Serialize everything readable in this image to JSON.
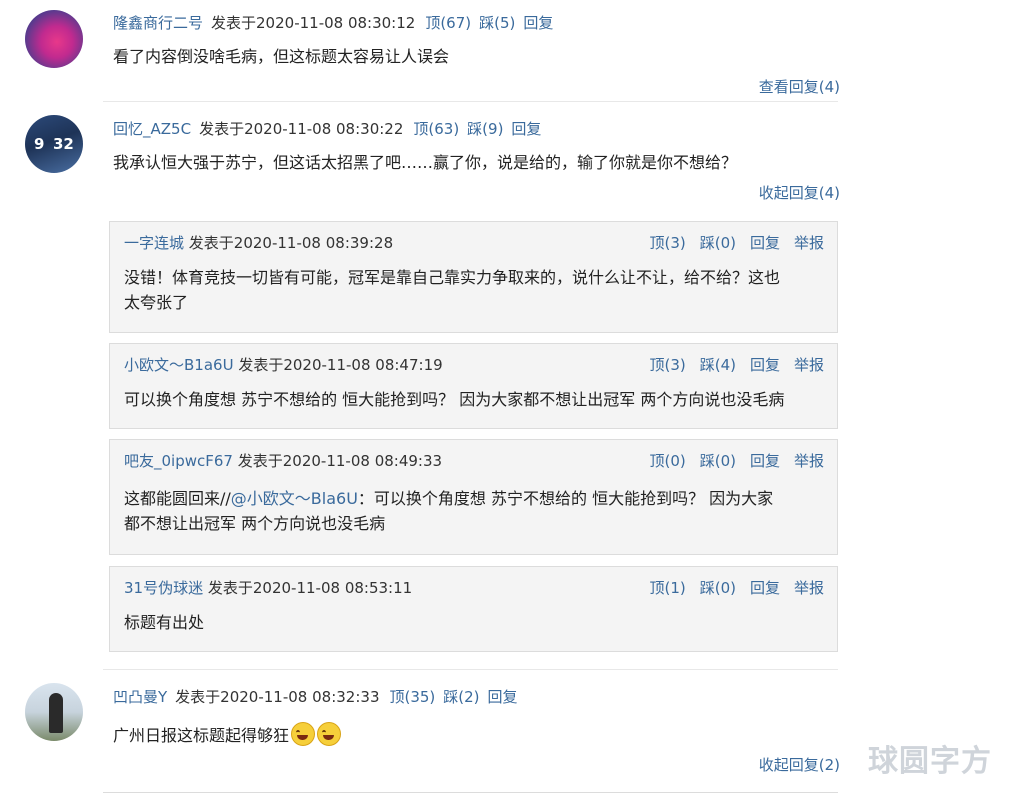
{
  "comments": [
    {
      "user": "隆鑫商行二号",
      "date": "发表于2020-11-08 08:30:12",
      "up": "顶(67)",
      "down": "踩(5)",
      "reply": "回复",
      "text": "看了内容倒没啥毛病，但这标题太容易让人误会",
      "toggle": "查看回复(4)"
    },
    {
      "user": "回忆_AZ5C",
      "date": "发表于2020-11-08 08:30:22",
      "up": "顶(63)",
      "down": "踩(9)",
      "reply": "回复",
      "text": "我承认恒大强于苏宁，但这话太招黑了吧……赢了你，说是给的，输了你就是你不想给？",
      "toggle": "收起回复(4)"
    },
    {
      "user": "凹凸曼Y",
      "date": "发表于2020-11-08 08:32:33",
      "up": "顶(35)",
      "down": "踩(2)",
      "reply": "回复",
      "text": "广州日报这标题起得够狂",
      "toggle": "收起回复(2)"
    }
  ],
  "replies": [
    {
      "user": "一字连城",
      "date": "发表于2020-11-08 08:39:28",
      "up": "顶(3)",
      "down": "踩(0)",
      "reply": "回复",
      "report": "举报",
      "line1": "没错！体育竞技一切皆有可能，冠军是靠自己靠实力争取来的，说什么让不让，给不给？这也",
      "line2": "太夸张了"
    },
    {
      "user": "小欧文～B1a6U",
      "date": "发表于2020-11-08 08:47:19",
      "up": "顶(3)",
      "down": "踩(4)",
      "reply": "回复",
      "report": "举报",
      "line1": "可以换个角度想 苏宁不想给的 恒大能抢到吗？ 因为大家都不想让出冠军 两个方向说也没毛病"
    },
    {
      "user": "吧友_0ipwcF67",
      "date": "发表于2020-11-08 08:49:33",
      "up": "顶(0)",
      "down": "踩(0)",
      "reply": "回复",
      "report": "举报",
      "prefix": "这都能圆回来//",
      "mention": "@小欧文～Bla6U",
      "line1_rest": "：可以换个角度想 苏宁不想给的 恒大能抢到吗？ 因为大家",
      "line2": "都不想让出冠军 两个方向说也没毛病"
    },
    {
      "user": "31号伪球迷",
      "date": "发表于2020-11-08 08:53:11",
      "up": "顶(1)",
      "down": "踩(0)",
      "reply": "回复",
      "report": "举报",
      "line1": "标题有出处"
    }
  ],
  "watermark": "球圆字方",
  "colors": {
    "link": "#3a6a9c",
    "reply_bg": "#f4f4f4"
  }
}
